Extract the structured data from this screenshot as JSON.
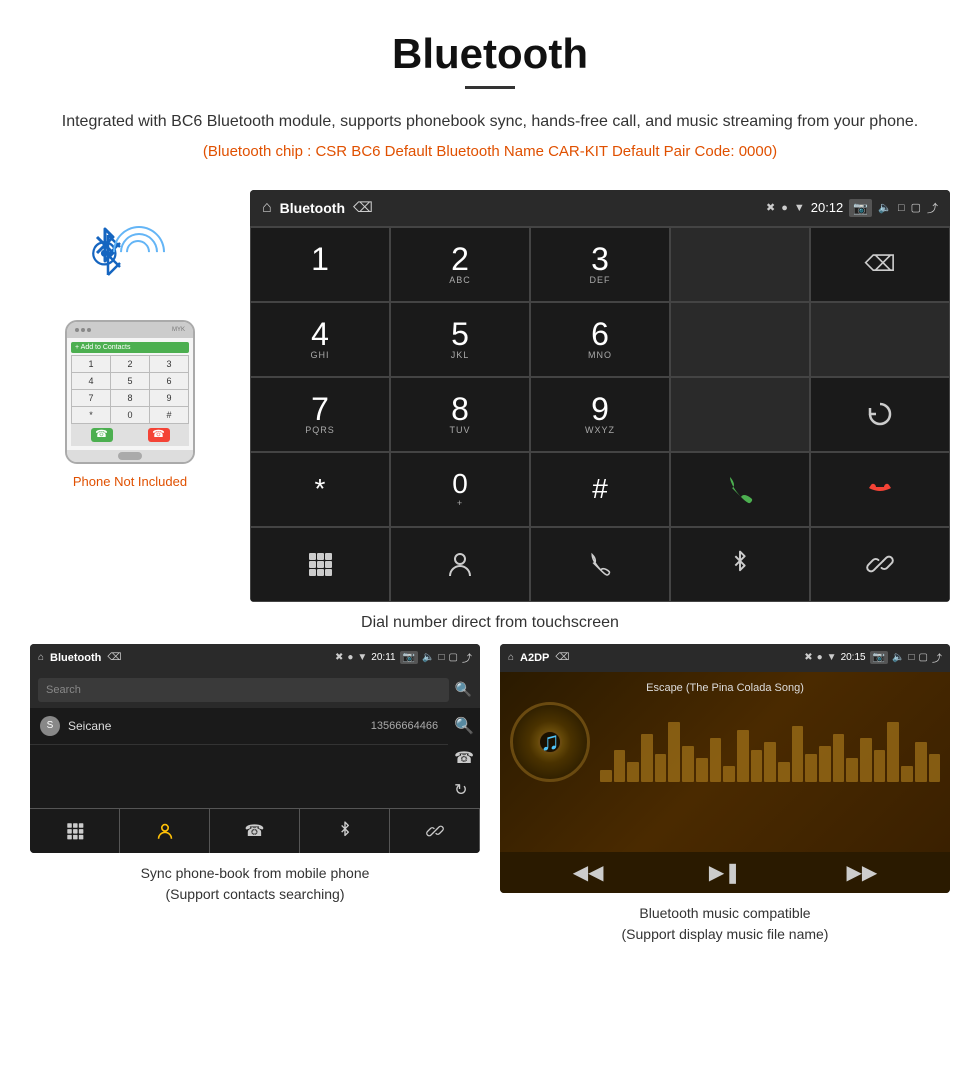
{
  "header": {
    "title": "Bluetooth",
    "description": "Integrated with BC6 Bluetooth module, supports phonebook sync, hands-free call, and music streaming from your phone.",
    "specs": "(Bluetooth chip : CSR BC6    Default Bluetooth Name CAR-KIT    Default Pair Code: 0000)"
  },
  "car_screen": {
    "title": "Bluetooth",
    "time": "20:12",
    "dialpad": {
      "keys": [
        {
          "digit": "1",
          "sub": ""
        },
        {
          "digit": "2",
          "sub": "ABC"
        },
        {
          "digit": "3",
          "sub": "DEF"
        },
        {
          "digit": "",
          "sub": ""
        },
        {
          "digit": "⌫",
          "sub": ""
        },
        {
          "digit": "4",
          "sub": "GHI"
        },
        {
          "digit": "5",
          "sub": "JKL"
        },
        {
          "digit": "6",
          "sub": "MNO"
        },
        {
          "digit": "",
          "sub": ""
        },
        {
          "digit": "",
          "sub": ""
        },
        {
          "digit": "7",
          "sub": "PQRS"
        },
        {
          "digit": "8",
          "sub": "TUV"
        },
        {
          "digit": "9",
          "sub": "WXYZ"
        },
        {
          "digit": "",
          "sub": ""
        },
        {
          "digit": "↺",
          "sub": ""
        },
        {
          "digit": "*",
          "sub": ""
        },
        {
          "digit": "0",
          "sub": "+"
        },
        {
          "digit": "#",
          "sub": ""
        },
        {
          "digit": "📞",
          "sub": ""
        },
        {
          "digit": "📵",
          "sub": ""
        }
      ]
    }
  },
  "dial_caption": "Dial number direct from touchscreen",
  "contacts_screen": {
    "title": "Bluetooth",
    "time": "20:11",
    "search_placeholder": "Search",
    "contact": {
      "letter": "S",
      "name": "Seicane",
      "number": "13566664466"
    }
  },
  "contacts_caption_line1": "Sync phone-book from mobile phone",
  "contacts_caption_line2": "(Support contacts searching)",
  "music_screen": {
    "title": "A2DP",
    "time": "20:15",
    "song_title": "Escape (The Pina Colada Song)",
    "eq_bars": [
      3,
      8,
      5,
      12,
      7,
      15,
      9,
      6,
      11,
      4,
      13,
      8,
      10,
      5,
      14,
      7,
      9,
      12,
      6,
      11,
      8,
      15,
      4,
      10,
      7
    ]
  },
  "music_caption_line1": "Bluetooth music compatible",
  "music_caption_line2": "(Support display music file name)",
  "phone_not_included": "Phone Not Included",
  "dialpad_keys": [
    "1",
    "2",
    "3",
    "4",
    "5",
    "6",
    "7",
    "8",
    "9",
    "*",
    "0",
    "#"
  ],
  "dialpad_subs": [
    "",
    "ABC",
    "DEF",
    "GHI",
    "JKL",
    "MNO",
    "PQRS",
    "TUV",
    "WXYZ",
    "",
    "+",
    ""
  ]
}
